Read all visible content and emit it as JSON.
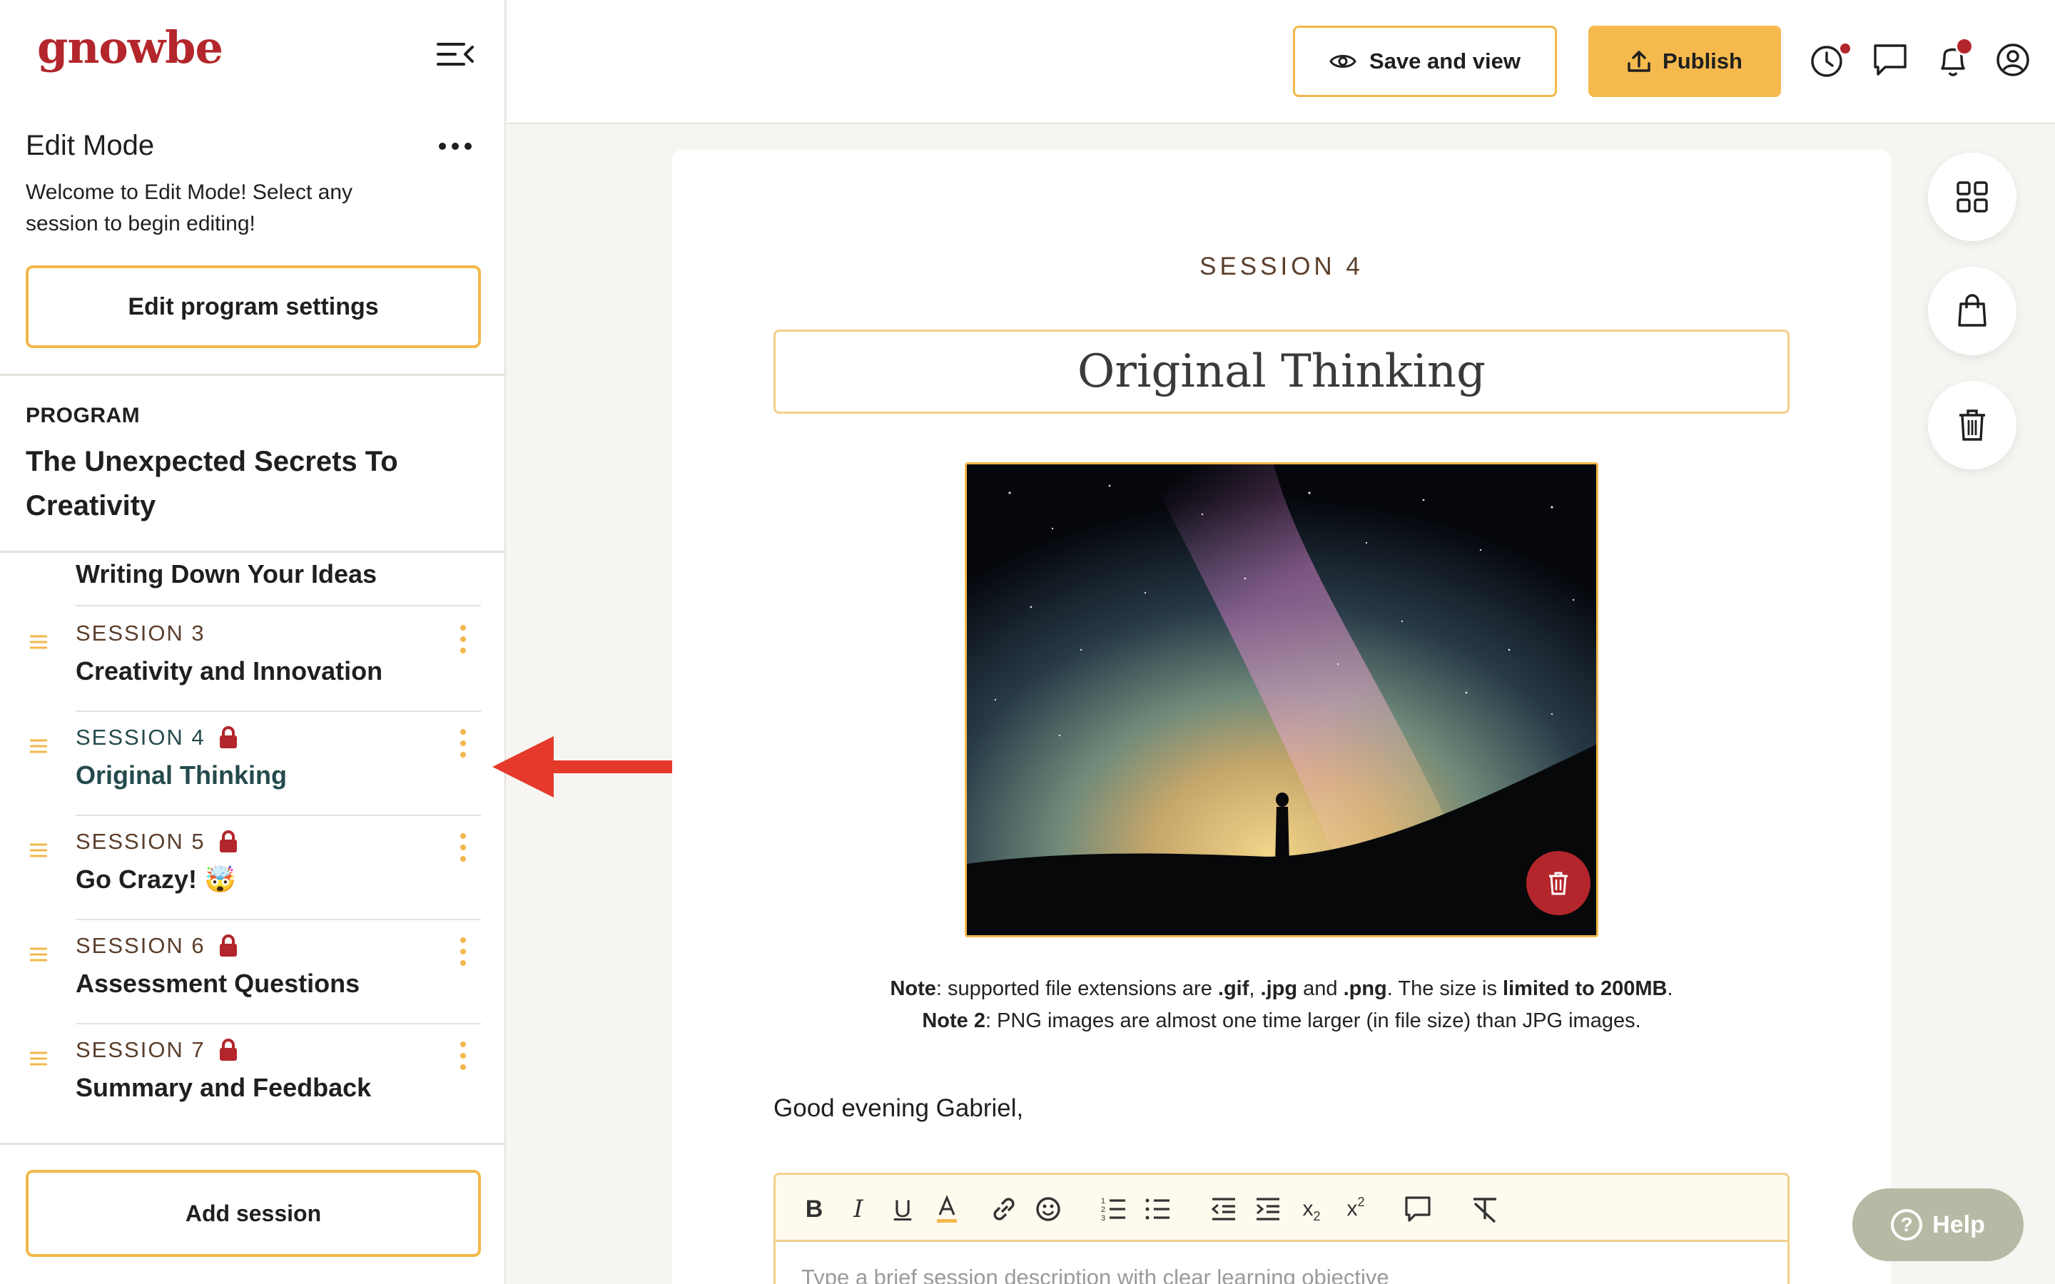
{
  "brand": {
    "logo": "gnowbe",
    "accent": "#f2b84b",
    "brand_red": "#b3262b"
  },
  "sidebar": {
    "edit_mode_title": "Edit Mode",
    "edit_mode_desc": "Welcome to Edit Mode! Select any session to begin editing!",
    "edit_settings_label": "Edit program settings",
    "program_label": "PROGRAM",
    "program_title": "The Unexpected Secrets To Creativity",
    "prev_item": "Writing Down Your Ideas",
    "sessions": [
      {
        "num": "SESSION 3",
        "name": "Creativity and Innovation",
        "locked": false
      },
      {
        "num": "SESSION 4",
        "name": "Original Thinking",
        "locked": true,
        "active": true
      },
      {
        "num": "SESSION 5",
        "name": "Go Crazy! 🤯",
        "locked": true
      },
      {
        "num": "SESSION 6",
        "name": "Assessment Questions",
        "locked": true
      },
      {
        "num": "SESSION 7",
        "name": "Summary and Feedback",
        "locked": true
      }
    ],
    "add_session_label": "Add session"
  },
  "topbar": {
    "save_label": "Save and view",
    "publish_label": "Publish",
    "icons": [
      "history-icon",
      "chat-icon",
      "bell-icon",
      "user-icon"
    ]
  },
  "main": {
    "session_label": "SESSION 4",
    "title": "Original Thinking",
    "note1": {
      "prefix": "Note",
      "t1": ": supported file extensions are ",
      "ext1": ".gif",
      "sep1": ", ",
      "ext2": ".jpg",
      "sep2": " and ",
      "ext3": ".png",
      "t2": ". The size is ",
      "limit": "limited to 200MB",
      "t3": "."
    },
    "note2": {
      "prefix": "Note 2",
      "text": ": PNG images are almost one time larger (in file size) than JPG images."
    },
    "greeting": "Good evening Gabriel,",
    "editor_placeholder": "Type a brief session description with clear learning objective"
  },
  "help_label": "Help"
}
